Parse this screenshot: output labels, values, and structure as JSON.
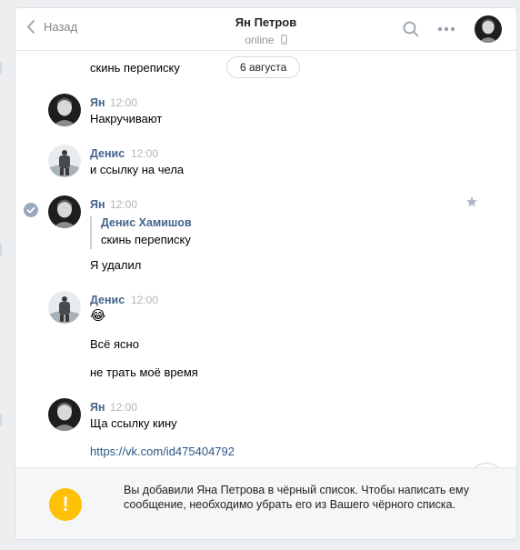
{
  "header": {
    "back_label": "Назад",
    "title": "Ян Петров",
    "status": "online"
  },
  "date_separator": "6 августа",
  "messages": [
    {
      "kind": "continuation",
      "text": "скинь переписку"
    },
    {
      "author": "Ян",
      "time": "12:00",
      "text": "Накручивают"
    },
    {
      "author": "Денис",
      "time": "12:00",
      "text": "и ссылку на чела"
    },
    {
      "author": "Ян",
      "time": "12:00",
      "quote": {
        "author": "Денис Хамишов",
        "text": "скинь переписку"
      },
      "text": "Я удалил"
    },
    {
      "author": "Денис",
      "time": "12:00",
      "emoji": "😂",
      "lines": [
        "Всё ясно",
        "не трать моё время"
      ]
    },
    {
      "author": "Ян",
      "time": "12:00",
      "text": "Ща ссылку кину",
      "link": "https://vk.com/id475404792"
    }
  ],
  "notice": {
    "text": "Вы добавили Яна Петрова в чёрный список. Чтобы написать ему сообщение, необходимо убрать его из Вашего чёрного списка.",
    "icon": "!"
  },
  "icons": {
    "back": "chevron-left-icon",
    "search": "search-icon",
    "more": "more-dots-icon",
    "phone": "mobile-phone-icon",
    "star": "star-icon",
    "check": "check-icon",
    "scroll": "chevron-down-icon",
    "warning": "warning-icon"
  },
  "colors": {
    "link": "#2a5885",
    "author": "#42648b",
    "warning": "#ffc107",
    "background": "#edeef0"
  }
}
